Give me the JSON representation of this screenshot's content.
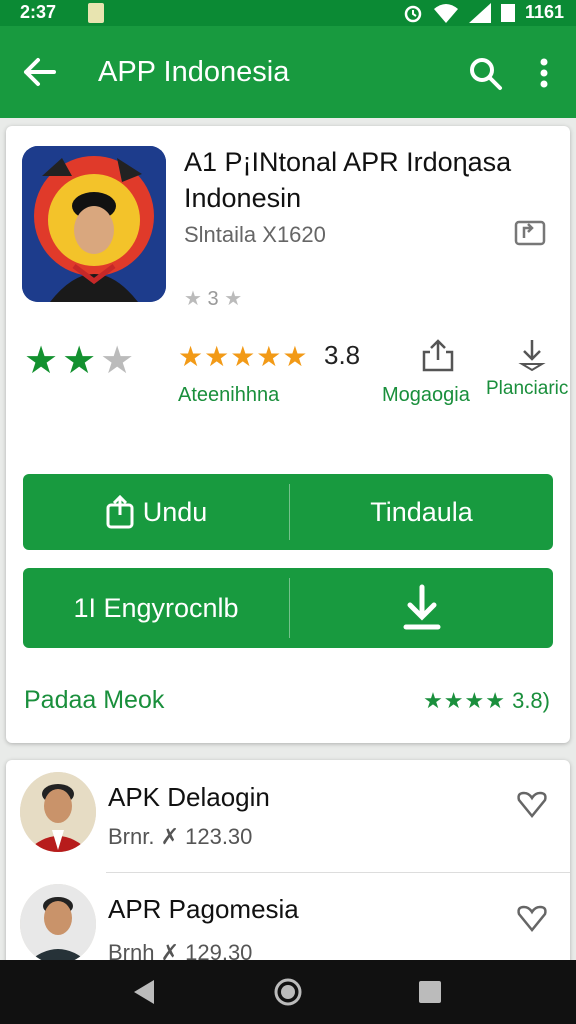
{
  "status_bar": {
    "time": "2:37",
    "battery_text": "1161"
  },
  "app_bar": {
    "title": "APP Indonesia"
  },
  "app": {
    "title": "A1 P¡INtonal APR Irdoɳasa Indonesin",
    "developer": "Slntaila X1620",
    "mini_rating": "3",
    "rating_value": "3.8",
    "category_label": "Ateenihhna",
    "share_label": "Mogaogia",
    "install_label": "Planciaric"
  },
  "buttons": {
    "primary_left": "Undu",
    "primary_right": "Tindaula",
    "secondary_left": "1I Engyrocnlb"
  },
  "footer": {
    "left": "Padaa Meok",
    "right_rating": "3.8)"
  },
  "list": [
    {
      "title": "APK Delaogin",
      "sub": "Brnr. ✗ 123.30"
    },
    {
      "title": "APR Pagomesia",
      "sub": "Brnh ✗ 129.30"
    }
  ],
  "colors": {
    "green": "#189a3f",
    "dark_green": "#0b8a34",
    "orange": "#f29a17"
  },
  "icons": [
    "back-arrow-icon",
    "search-icon",
    "more-vert-icon",
    "share-icon",
    "download-icon",
    "heart-icon"
  ]
}
